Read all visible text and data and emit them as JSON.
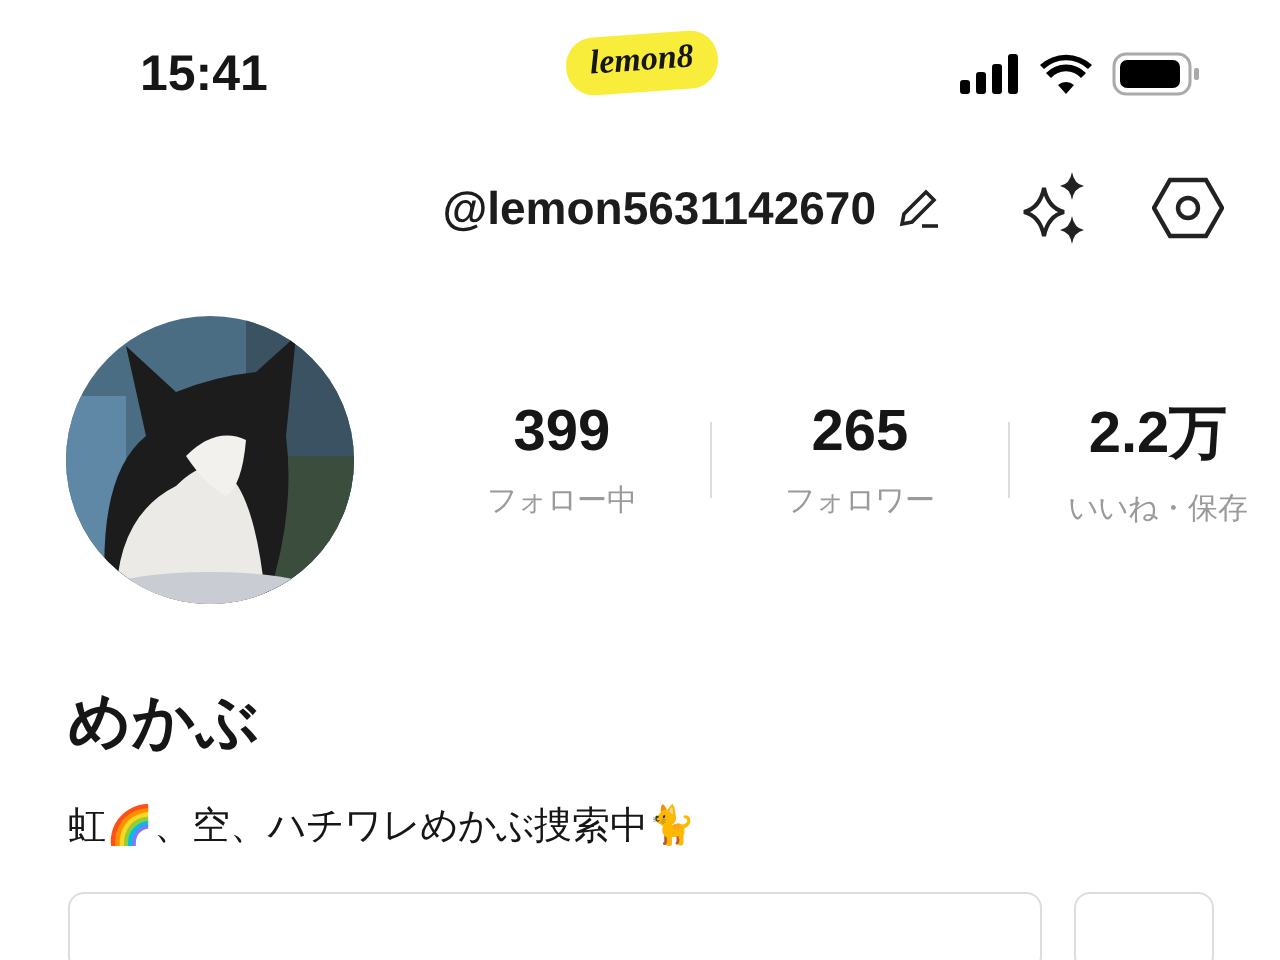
{
  "status_bar": {
    "time": "15:41"
  },
  "logo": {
    "text": "lemon8"
  },
  "header": {
    "handle": "@lemon5631142670"
  },
  "stats": [
    {
      "value": "399",
      "label": "フォロー中"
    },
    {
      "value": "265",
      "label": "フォロワー"
    },
    {
      "value": "2.2万",
      "label": "いいね・保存"
    }
  ],
  "profile": {
    "name": "めかぶ",
    "bio": "虹🌈、空、ハチワレめかぶ捜索中🐈"
  },
  "buttons": [
    {
      "kind": "wide"
    },
    {
      "kind": "narrow"
    }
  ]
}
